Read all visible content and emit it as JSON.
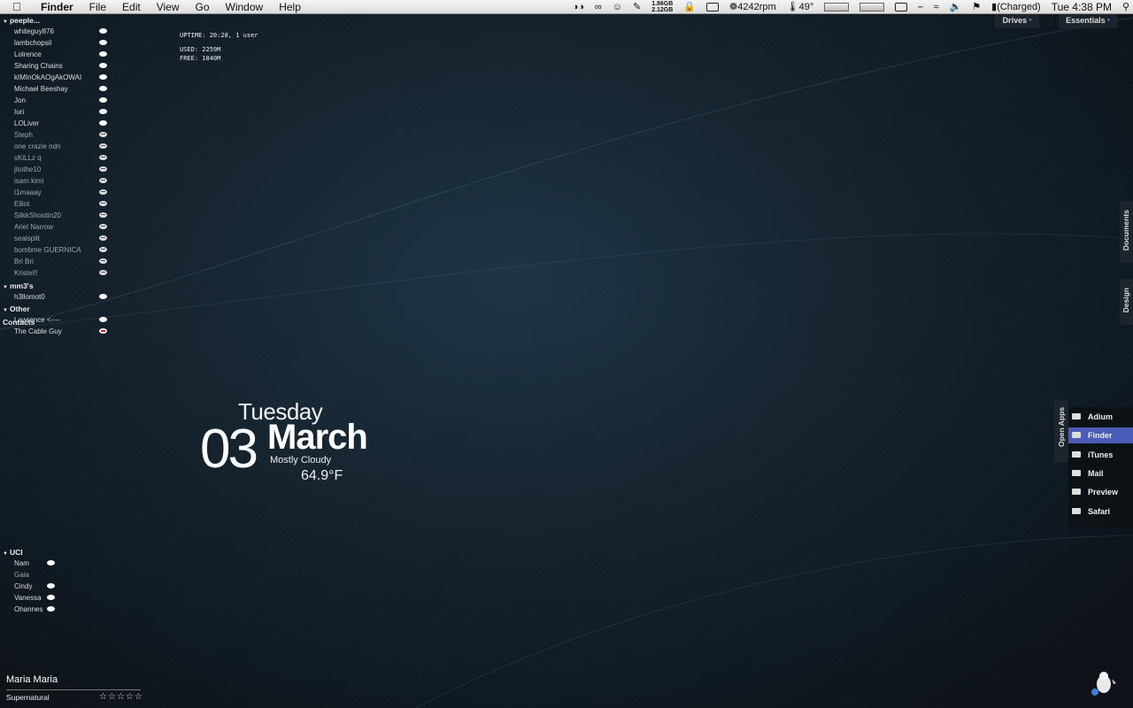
{
  "menubar": {
    "apple": "",
    "items": [
      "Finder",
      "File",
      "Edit",
      "View",
      "Go",
      "Window",
      "Help"
    ],
    "memory_top": "1.86GB",
    "memory_bottom": "2.12GB",
    "fan_rpm": "4242rpm",
    "temperature": "49°",
    "battery_status": "(Charged)",
    "clock": "Tue 4:38 PM"
  },
  "buddy_list": {
    "groups": [
      {
        "name": "peeple...",
        "contacts": [
          {
            "name": "whiteguy876",
            "status": "available"
          },
          {
            "name": "lambchopsil",
            "status": "available"
          },
          {
            "name": "Lolrence",
            "status": "available"
          },
          {
            "name": "Sharing Chains",
            "status": "available"
          },
          {
            "name": "kIMInOkAOgAkOWAI",
            "status": "available"
          },
          {
            "name": "Michael Beeshay",
            "status": "available"
          },
          {
            "name": "Jon",
            "status": "available"
          },
          {
            "name": "Iuri",
            "status": "available"
          },
          {
            "name": "LOLiver",
            "status": "available"
          },
          {
            "name": "Steph",
            "status": "away"
          },
          {
            "name": "one crazie ndn",
            "status": "away"
          },
          {
            "name": "sKiLLz q",
            "status": "away"
          },
          {
            "name": "jitothe10",
            "status": "away"
          },
          {
            "name": "isam kimi",
            "status": "away"
          },
          {
            "name": "t1maaay",
            "status": "away"
          },
          {
            "name": "Elliot",
            "status": "away"
          },
          {
            "name": "SilkkShootin20",
            "status": "away"
          },
          {
            "name": "Ariel Narrow",
            "status": "away"
          },
          {
            "name": "sealsplit",
            "status": "away"
          },
          {
            "name": "bombme GUERNICA",
            "status": "away"
          },
          {
            "name": "Bri Bri",
            "status": "away"
          },
          {
            "name": "Kristel!!",
            "status": "away"
          }
        ]
      },
      {
        "name": "mm3's",
        "contacts": [
          {
            "name": "h3llomot0",
            "status": "available"
          }
        ]
      },
      {
        "name": "Other Contacts",
        "contacts": [
          {
            "name": "Lawrence <----",
            "status": "available"
          },
          {
            "name": "The Cable Guy",
            "status": "busy"
          }
        ]
      },
      {
        "name": "UCI",
        "contacts": [
          {
            "name": "Nam",
            "status": "available"
          },
          {
            "name": "Gaia",
            "status": "none"
          },
          {
            "name": "Cindy",
            "status": "available"
          },
          {
            "name": "Vanessa",
            "status": "available"
          },
          {
            "name": "Ohannes",
            "status": "mobile"
          }
        ]
      }
    ]
  },
  "system_stats": {
    "uptime": "UPTIME: 20:28, 1 user",
    "used": "USED: 2259M",
    "free": "FREE: 1840M"
  },
  "date_widget": {
    "day_name": "Tuesday",
    "day_number": "03",
    "month": "March",
    "condition": "Mostly Cloudy",
    "temperature": "64.9°F"
  },
  "stacks": {
    "top": [
      "Drives",
      "Essentials"
    ],
    "side": [
      "Documents",
      "Design"
    ],
    "open_apps_label": "Open Apps"
  },
  "open_apps": [
    {
      "name": "Adium",
      "active": false
    },
    {
      "name": "Finder",
      "active": true
    },
    {
      "name": "iTunes",
      "active": false
    },
    {
      "name": "Mail",
      "active": false
    },
    {
      "name": "Preview",
      "active": false
    },
    {
      "name": "Safari",
      "active": false
    }
  ],
  "now_playing": {
    "title": "Maria Maria",
    "artist": "Supernatural",
    "stars": "☆☆☆☆☆"
  },
  "colors": {
    "accent": "#4a5bb8",
    "background": "#14222d",
    "stack_dot": "#5a9be0"
  }
}
